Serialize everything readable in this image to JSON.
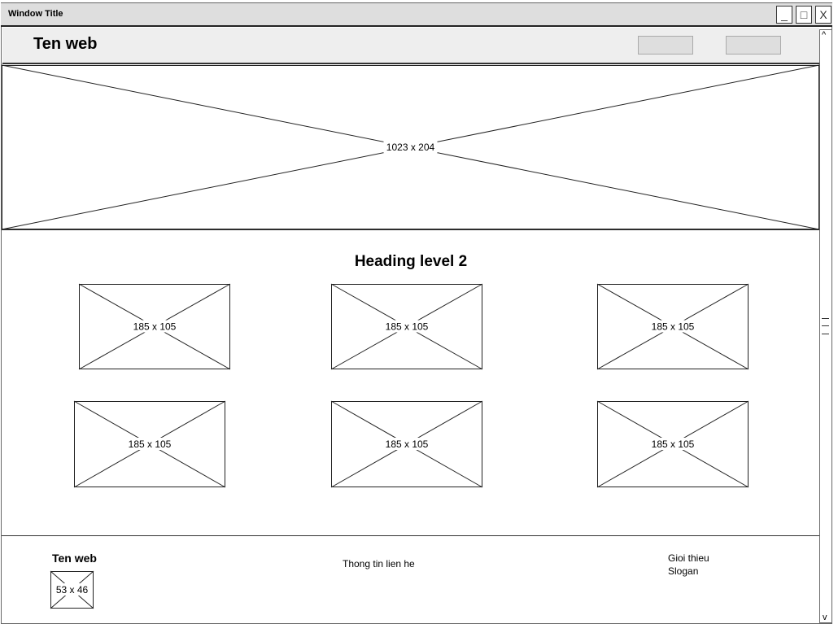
{
  "window": {
    "title": "Window Title",
    "controls": [
      "_",
      "□",
      "X"
    ]
  },
  "header": {
    "site_name": "Ten web",
    "buttons": [
      "",
      ""
    ]
  },
  "hero": {
    "label": "1023 x 204"
  },
  "main": {
    "heading": "Heading level 2",
    "thumbnails": [
      "185 x 105",
      "185 x 105",
      "185 x 105",
      "185 x 105",
      "185 x 105",
      "185 x 105"
    ]
  },
  "footer": {
    "site_name": "Ten web",
    "logo_label": "53 x 46",
    "contact": "Thong tin lien he",
    "about": "Gioi thieu",
    "slogan": "Slogan"
  },
  "scrollbar": {
    "up": "^",
    "down": "v"
  },
  "colors": {
    "titlebar": "#dedede",
    "header": "#eeeeee",
    "button": "#dedede"
  }
}
